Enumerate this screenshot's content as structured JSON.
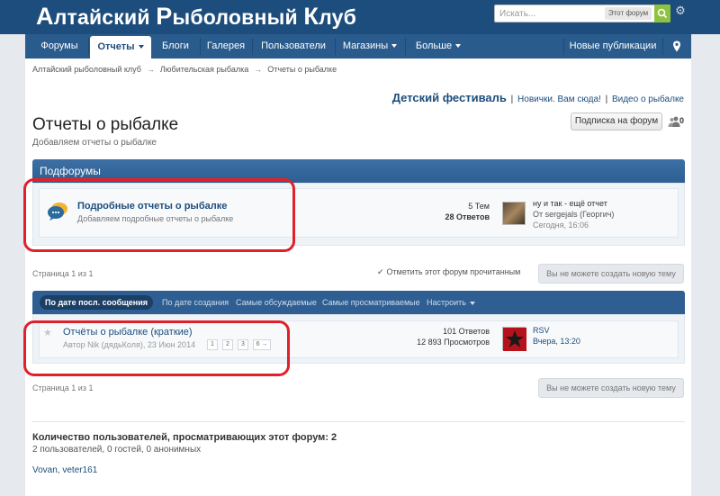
{
  "header": {
    "logo": {
      "w1_first": "А",
      "w1_rest": "лтайский ",
      "w2_first": "Р",
      "w2_rest": "ыболовный ",
      "w3_first": "К",
      "w3_rest": "луб"
    },
    "search_placeholder": "Искать...",
    "search_scope": "Этот форум"
  },
  "nav": {
    "items": [
      {
        "label": "Форумы"
      },
      {
        "label": "Отчеты"
      },
      {
        "label": "Блоги"
      },
      {
        "label": "Галерея"
      },
      {
        "label": "Пользователи"
      },
      {
        "label": "Магазины"
      },
      {
        "label": "Больше"
      },
      {
        "label": "Новые публикации"
      }
    ]
  },
  "breadcrumb": {
    "items": [
      "Алтайский рыболовный клуб",
      "Любительская рыбалка",
      "Отчеты о рыбалке"
    ],
    "separator": "→"
  },
  "notices": {
    "featured": "Детский фестиваль",
    "links": [
      "Новички. Вам сюда!",
      "Видео о рыбалке"
    ],
    "separator": "|"
  },
  "page": {
    "title": "Отчеты о рыбалке",
    "description": "Добавляем отчеты о рыбалке",
    "subscribe_label": "Подписка на форум",
    "viewers_count": "0"
  },
  "subforums": {
    "header": "Подфорумы",
    "items": [
      {
        "title": "Подробные отчеты о рыбалке",
        "description": "Добавляем подробные отчеты о рыбалке",
        "topics": "5 Тем",
        "replies": "28 Ответов",
        "last_title": "ну и так - ещё отчет",
        "last_by": "От sergejals (Георгич)",
        "last_time": "Сегодня, 16:06"
      }
    ]
  },
  "pagination": {
    "text": "Страница 1 из 1",
    "mark_read": "Отметить этот форум прочитанным",
    "no_new_topic": "Вы не можете создать новую тему"
  },
  "sort": {
    "items": [
      "По дате посл. сообщения",
      "По дате создания",
      "Самые обсуждаемые",
      "Самые просматриваемые",
      "Настроить"
    ]
  },
  "threads": [
    {
      "title": "Отчёты о рыбалке (краткие)",
      "meta": "Автор Nik (дядьКоля), 23 Июн 2014",
      "pages": [
        "1",
        "2",
        "3",
        "6 →"
      ],
      "replies": "101 Ответов",
      "views": "12 893 Просмотров",
      "last_user": "RSV",
      "last_time": "Вчера, 13:20"
    }
  ],
  "online": {
    "title": "Количество пользователей, просматривающих этот форум: 2",
    "description": "2 пользователей, 0 гостей, 0 анонимных",
    "users": "Vovan, veter161"
  },
  "colors": {
    "brand": "#1d4d7c",
    "nav": "#2a5b8d",
    "annotation": "#e0202a",
    "search_button": "#8ec33f"
  },
  "icons": [
    "search-icon",
    "gear-icon",
    "location-pin-icon",
    "chat-bubbles-icon",
    "users-icon",
    "star-icon",
    "check-icon"
  ]
}
